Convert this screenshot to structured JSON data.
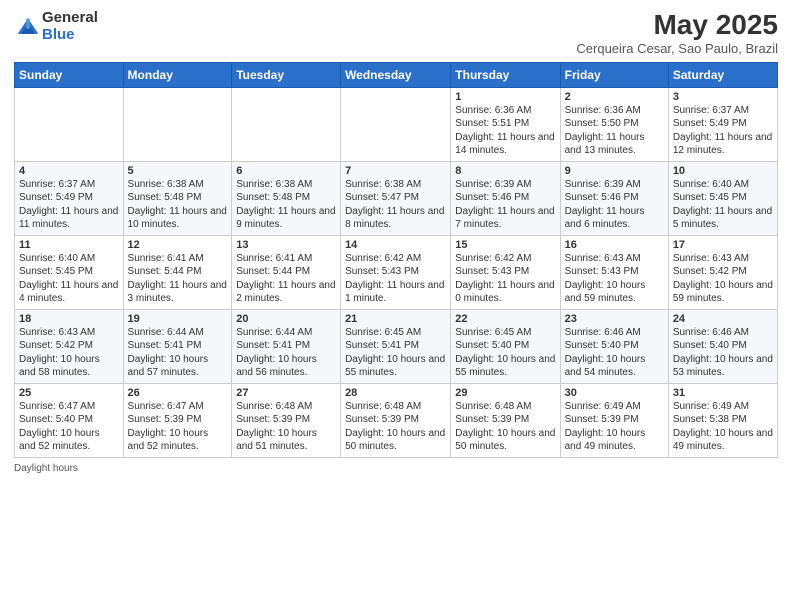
{
  "header": {
    "logo_general": "General",
    "logo_blue": "Blue",
    "title": "May 2025",
    "subtitle": "Cerqueira Cesar, Sao Paulo, Brazil"
  },
  "weekdays": [
    "Sunday",
    "Monday",
    "Tuesday",
    "Wednesday",
    "Thursday",
    "Friday",
    "Saturday"
  ],
  "footer": {
    "daylight_label": "Daylight hours"
  },
  "weeks": [
    [
      {
        "day": "",
        "info": ""
      },
      {
        "day": "",
        "info": ""
      },
      {
        "day": "",
        "info": ""
      },
      {
        "day": "",
        "info": ""
      },
      {
        "day": "1",
        "info": "Sunrise: 6:36 AM\nSunset: 5:51 PM\nDaylight: 11 hours and 14 minutes."
      },
      {
        "day": "2",
        "info": "Sunrise: 6:36 AM\nSunset: 5:50 PM\nDaylight: 11 hours and 13 minutes."
      },
      {
        "day": "3",
        "info": "Sunrise: 6:37 AM\nSunset: 5:49 PM\nDaylight: 11 hours and 12 minutes."
      }
    ],
    [
      {
        "day": "4",
        "info": "Sunrise: 6:37 AM\nSunset: 5:49 PM\nDaylight: 11 hours and 11 minutes."
      },
      {
        "day": "5",
        "info": "Sunrise: 6:38 AM\nSunset: 5:48 PM\nDaylight: 11 hours and 10 minutes."
      },
      {
        "day": "6",
        "info": "Sunrise: 6:38 AM\nSunset: 5:48 PM\nDaylight: 11 hours and 9 minutes."
      },
      {
        "day": "7",
        "info": "Sunrise: 6:38 AM\nSunset: 5:47 PM\nDaylight: 11 hours and 8 minutes."
      },
      {
        "day": "8",
        "info": "Sunrise: 6:39 AM\nSunset: 5:46 PM\nDaylight: 11 hours and 7 minutes."
      },
      {
        "day": "9",
        "info": "Sunrise: 6:39 AM\nSunset: 5:46 PM\nDaylight: 11 hours and 6 minutes."
      },
      {
        "day": "10",
        "info": "Sunrise: 6:40 AM\nSunset: 5:45 PM\nDaylight: 11 hours and 5 minutes."
      }
    ],
    [
      {
        "day": "11",
        "info": "Sunrise: 6:40 AM\nSunset: 5:45 PM\nDaylight: 11 hours and 4 minutes."
      },
      {
        "day": "12",
        "info": "Sunrise: 6:41 AM\nSunset: 5:44 PM\nDaylight: 11 hours and 3 minutes."
      },
      {
        "day": "13",
        "info": "Sunrise: 6:41 AM\nSunset: 5:44 PM\nDaylight: 11 hours and 2 minutes."
      },
      {
        "day": "14",
        "info": "Sunrise: 6:42 AM\nSunset: 5:43 PM\nDaylight: 11 hours and 1 minute."
      },
      {
        "day": "15",
        "info": "Sunrise: 6:42 AM\nSunset: 5:43 PM\nDaylight: 11 hours and 0 minutes."
      },
      {
        "day": "16",
        "info": "Sunrise: 6:43 AM\nSunset: 5:43 PM\nDaylight: 10 hours and 59 minutes."
      },
      {
        "day": "17",
        "info": "Sunrise: 6:43 AM\nSunset: 5:42 PM\nDaylight: 10 hours and 59 minutes."
      }
    ],
    [
      {
        "day": "18",
        "info": "Sunrise: 6:43 AM\nSunset: 5:42 PM\nDaylight: 10 hours and 58 minutes."
      },
      {
        "day": "19",
        "info": "Sunrise: 6:44 AM\nSunset: 5:41 PM\nDaylight: 10 hours and 57 minutes."
      },
      {
        "day": "20",
        "info": "Sunrise: 6:44 AM\nSunset: 5:41 PM\nDaylight: 10 hours and 56 minutes."
      },
      {
        "day": "21",
        "info": "Sunrise: 6:45 AM\nSunset: 5:41 PM\nDaylight: 10 hours and 55 minutes."
      },
      {
        "day": "22",
        "info": "Sunrise: 6:45 AM\nSunset: 5:40 PM\nDaylight: 10 hours and 55 minutes."
      },
      {
        "day": "23",
        "info": "Sunrise: 6:46 AM\nSunset: 5:40 PM\nDaylight: 10 hours and 54 minutes."
      },
      {
        "day": "24",
        "info": "Sunrise: 6:46 AM\nSunset: 5:40 PM\nDaylight: 10 hours and 53 minutes."
      }
    ],
    [
      {
        "day": "25",
        "info": "Sunrise: 6:47 AM\nSunset: 5:40 PM\nDaylight: 10 hours and 52 minutes."
      },
      {
        "day": "26",
        "info": "Sunrise: 6:47 AM\nSunset: 5:39 PM\nDaylight: 10 hours and 52 minutes."
      },
      {
        "day": "27",
        "info": "Sunrise: 6:48 AM\nSunset: 5:39 PM\nDaylight: 10 hours and 51 minutes."
      },
      {
        "day": "28",
        "info": "Sunrise: 6:48 AM\nSunset: 5:39 PM\nDaylight: 10 hours and 50 minutes."
      },
      {
        "day": "29",
        "info": "Sunrise: 6:48 AM\nSunset: 5:39 PM\nDaylight: 10 hours and 50 minutes."
      },
      {
        "day": "30",
        "info": "Sunrise: 6:49 AM\nSunset: 5:39 PM\nDaylight: 10 hours and 49 minutes."
      },
      {
        "day": "31",
        "info": "Sunrise: 6:49 AM\nSunset: 5:38 PM\nDaylight: 10 hours and 49 minutes."
      }
    ]
  ]
}
